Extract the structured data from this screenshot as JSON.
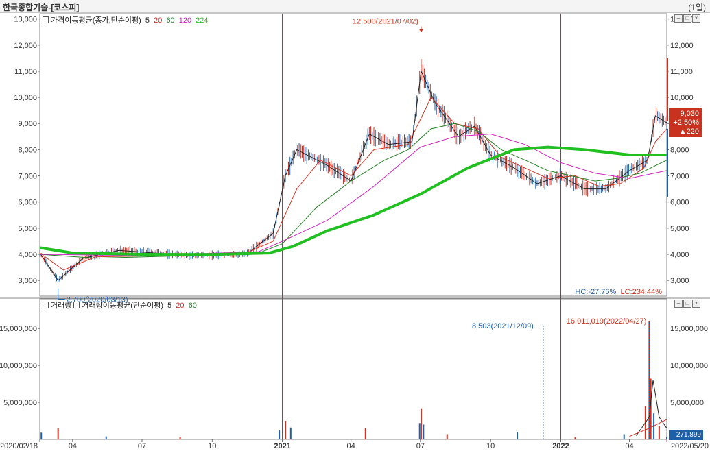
{
  "window": {
    "title": "한국종합기술-[코스피]",
    "period": "(1일)"
  },
  "price_panel": {
    "legend_title": "가격이동평균(종가,단순이평)",
    "ma_labels": [
      "5",
      "20",
      "60",
      "120",
      "224"
    ],
    "ma_colors": [
      "#222222",
      "#d03020",
      "#208020",
      "#d020c0",
      "#20c020"
    ],
    "hc_text": "HC:-27.76%",
    "lc_text": "LC:234.44%",
    "current_price": "9,030",
    "change_pct": "+2.50%",
    "change_abs": "▲220"
  },
  "volume_panel": {
    "legend_title": "거래량",
    "legend_ma_title": "거래량이동평균(단순이평)",
    "ma_labels": [
      "5",
      "20",
      "60"
    ],
    "current_volume": "271,899"
  },
  "chart_data": [
    {
      "type": "line",
      "title": "가격이동평균(종가,단순이평)",
      "xlabel": "",
      "ylabel": "",
      "ylim": [
        2400,
        13200
      ],
      "y_ticks": [
        "3,000",
        "4,000",
        "5,000",
        "6,000",
        "7,000",
        "8,000",
        "9,000",
        "10,000",
        "11,000",
        "12,000",
        "13,000"
      ],
      "x_tick_labels": [
        "2020/02/18",
        "04",
        "07",
        "10",
        "2021",
        "04",
        "07",
        "10",
        "2022",
        "04",
        "2022/05/20"
      ],
      "x_tick_dates": [
        "2020-02-18",
        "2020-04-01",
        "2020-07-01",
        "2020-10-01",
        "2021-01-01",
        "2021-04-01",
        "2021-07-01",
        "2021-10-01",
        "2022-01-01",
        "2022-04-01",
        "2022-05-20"
      ],
      "vertical_markers": [
        "2021-01-01",
        "2022-01-01"
      ],
      "annotations": [
        {
          "text": "12,500(2021/07/02)",
          "date": "2021-07-02",
          "value": 12500,
          "kind": "high"
        },
        {
          "text": "2,700(2020/03/13)",
          "date": "2020-03-13",
          "value": 2700,
          "kind": "low"
        }
      ],
      "series": [
        {
          "name": "5",
          "x": [
            "2020-02-18",
            "2020-03-13",
            "2020-04-15",
            "2020-06-01",
            "2020-09-01",
            "2020-11-15",
            "2020-12-20",
            "2021-01-05",
            "2021-01-20",
            "2021-03-01",
            "2021-04-01",
            "2021-04-25",
            "2021-05-20",
            "2021-06-20",
            "2021-07-02",
            "2021-07-20",
            "2021-08-20",
            "2021-09-10",
            "2021-10-01",
            "2021-11-01",
            "2021-12-01",
            "2022-01-01",
            "2022-02-01",
            "2022-03-01",
            "2022-04-01",
            "2022-04-25",
            "2022-05-05",
            "2022-05-20"
          ],
          "values": [
            4050,
            3000,
            3850,
            4150,
            3950,
            4000,
            4800,
            7000,
            8000,
            7400,
            6800,
            8600,
            8200,
            8300,
            11000,
            9800,
            8500,
            8900,
            7800,
            7300,
            6700,
            7000,
            6500,
            6500,
            7200,
            7600,
            9300,
            9030
          ]
        },
        {
          "name": "20",
          "x": [
            "2020-02-18",
            "2020-03-20",
            "2020-05-01",
            "2020-08-01",
            "2020-11-15",
            "2020-12-20",
            "2021-01-20",
            "2021-02-20",
            "2021-04-01",
            "2021-05-01",
            "2021-06-15",
            "2021-07-15",
            "2021-08-15",
            "2021-09-15",
            "2021-10-15",
            "2021-11-15",
            "2021-12-15",
            "2022-01-20",
            "2022-02-20",
            "2022-03-20",
            "2022-04-20",
            "2022-05-05",
            "2022-05-20"
          ],
          "values": [
            4050,
            3400,
            3900,
            3950,
            4050,
            4500,
            6500,
            7600,
            7000,
            8000,
            8200,
            10000,
            9000,
            8800,
            7700,
            7300,
            6900,
            7000,
            6600,
            6700,
            7300,
            8300,
            8800
          ]
        },
        {
          "name": "60",
          "x": [
            "2020-02-18",
            "2020-05-01",
            "2020-09-01",
            "2020-12-01",
            "2021-01-01",
            "2021-02-15",
            "2021-04-01",
            "2021-05-15",
            "2021-06-15",
            "2021-07-15",
            "2021-08-15",
            "2021-09-15",
            "2021-10-15",
            "2021-11-15",
            "2021-12-15",
            "2022-01-15",
            "2022-02-15",
            "2022-03-15",
            "2022-04-15",
            "2022-05-20"
          ],
          "values": [
            4000,
            3850,
            3950,
            4050,
            4400,
            5800,
            6800,
            7600,
            8000,
            8800,
            9000,
            8700,
            8000,
            7600,
            7200,
            7000,
            6800,
            6900,
            7100,
            7600
          ]
        },
        {
          "name": "120",
          "x": [
            "2020-02-18",
            "2020-07-01",
            "2020-12-01",
            "2021-01-01",
            "2021-03-01",
            "2021-05-01",
            "2021-07-01",
            "2021-08-15",
            "2021-10-01",
            "2021-11-15",
            "2022-01-01",
            "2022-02-15",
            "2022-04-01",
            "2022-05-20"
          ],
          "values": [
            4000,
            3950,
            4100,
            4500,
            5300,
            6600,
            8100,
            8500,
            8600,
            8200,
            7500,
            7100,
            6900,
            7200
          ]
        },
        {
          "name": "224",
          "x": [
            "2020-02-18",
            "2020-04-01",
            "2020-07-01",
            "2020-10-01",
            "2020-12-15",
            "2021-01-15",
            "2021-03-01",
            "2021-05-01",
            "2021-07-01",
            "2021-09-01",
            "2021-11-01",
            "2021-12-15",
            "2022-02-01",
            "2022-04-01",
            "2022-05-20"
          ],
          "values": [
            4250,
            4050,
            4000,
            3990,
            4050,
            4300,
            4900,
            5500,
            6300,
            7300,
            8000,
            8100,
            8000,
            7800,
            7800
          ]
        }
      ]
    },
    {
      "type": "bar",
      "title": "거래량",
      "xlabel": "",
      "ylabel": "",
      "ylim": [
        0,
        19000000
      ],
      "y_ticks": [
        "5,000,000",
        "10,000,000",
        "15,000,000"
      ],
      "annotations": [
        {
          "text": "16,011,019(2022/04/27)",
          "date": "2022-04-27",
          "value": 16011019,
          "kind": "high"
        },
        {
          "text": "8,503(2021/12/09)",
          "date": "2021-12-09",
          "value": 8503,
          "kind": "low"
        }
      ],
      "categories": [
        "2020-02-20",
        "2020-03-13",
        "2020-05-15",
        "2020-08-20",
        "2020-12-28",
        "2021-01-05",
        "2021-01-12",
        "2021-04-20",
        "2021-06-30",
        "2021-07-02",
        "2021-07-05",
        "2021-08-05",
        "2021-11-05",
        "2022-01-20",
        "2022-03-25",
        "2022-04-22",
        "2022-04-27",
        "2022-04-29",
        "2022-05-03",
        "2022-05-10",
        "2022-05-20"
      ],
      "values": [
        900000,
        1500000,
        400000,
        300000,
        1200000,
        2500000,
        1600000,
        1500000,
        2200000,
        4200000,
        2000000,
        700000,
        1000000,
        300000,
        700000,
        4500000,
        16011019,
        8200000,
        3500000,
        1800000,
        271899
      ],
      "ma_series": [
        {
          "name": "5",
          "x": [
            "2022-04-10",
            "2022-04-27",
            "2022-05-02",
            "2022-05-10",
            "2022-05-20"
          ],
          "values": [
            500000,
            3000000,
            8000000,
            3000000,
            1500000
          ]
        },
        {
          "name": "20",
          "x": [
            "2022-04-01",
            "2022-04-27",
            "2022-05-20"
          ],
          "values": [
            400000,
            1500000,
            2700000
          ]
        }
      ]
    }
  ]
}
